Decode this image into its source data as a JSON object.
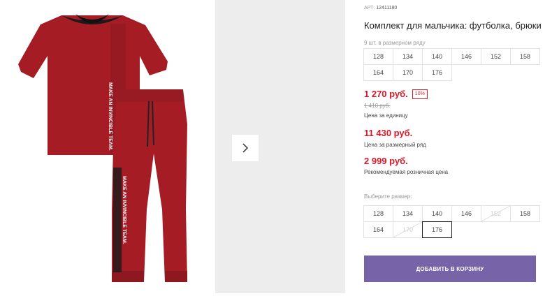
{
  "product": {
    "sku_label": "АРТ:",
    "sku": "12411180",
    "title": "Комплект для мальчика: футболка, брюки",
    "print_text": "MAKE AN INVINCIBLE TEAM."
  },
  "pack": {
    "note": "9 шт. в размерном ряду",
    "sizes": [
      "128",
      "134",
      "140",
      "146",
      "152",
      "158",
      "164",
      "170",
      "176"
    ]
  },
  "pricing": {
    "unit_price": "1 270 руб.",
    "discount": "10%",
    "old_price": "1 410 руб.",
    "unit_label": "Цена за единицу",
    "pack_price": "11 430 руб.",
    "pack_label": "Цена за размерный ряд",
    "rrp": "2 999 руб.",
    "rrp_label": "Рекомендуемая розничная цена"
  },
  "size_picker": {
    "label": "Выберите размер:",
    "sizes": [
      {
        "label": "128",
        "state": "available"
      },
      {
        "label": "134",
        "state": "available"
      },
      {
        "label": "140",
        "state": "available"
      },
      {
        "label": "146",
        "state": "available"
      },
      {
        "label": "152",
        "state": "disabled"
      },
      {
        "label": "158",
        "state": "available"
      },
      {
        "label": "164",
        "state": "available"
      },
      {
        "label": "170",
        "state": "disabled"
      },
      {
        "label": "176",
        "state": "selected"
      }
    ]
  },
  "cart_button": "ДОБАВИТЬ В КОРЗИНУ",
  "colors": {
    "price_red": "#d91a2a",
    "button": "#7764a8",
    "garment": "#a51c24"
  },
  "icons": {
    "gallery_next": "chevron-right-icon"
  }
}
